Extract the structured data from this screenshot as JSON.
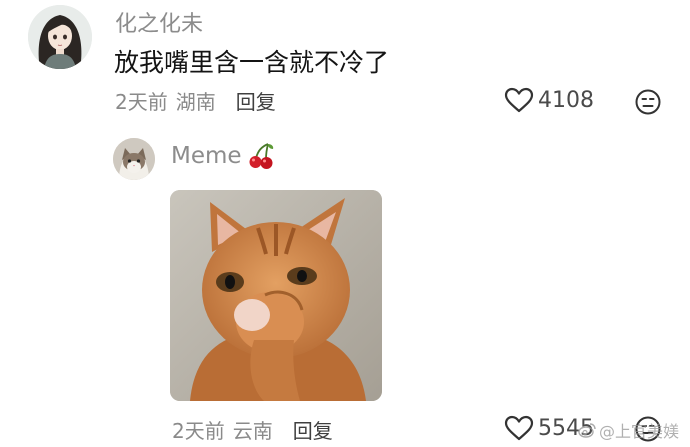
{
  "main_comment": {
    "username": "化之化未",
    "text": "放我嘴里含一含就不冷了",
    "time": "2天前",
    "location": "湖南",
    "reply_label": "回复",
    "likes": "4108",
    "avatar_icon": "anime-girl-avatar",
    "like_icon": "heart-outline-icon",
    "extra_icon": "neutral-face-icon"
  },
  "reply_comment": {
    "username": "Meme",
    "emoji": "cherry-icon",
    "image": "orange-cat-photo",
    "time": "2天前",
    "location": "云南",
    "reply_label": "回复",
    "likes": "5545",
    "avatar_icon": "cat-avatar",
    "like_icon": "heart-outline-icon",
    "extra_icon": "neutral-face-icon"
  },
  "watermark": {
    "text": "@上官美媄",
    "icon": "weibo-logo-icon"
  },
  "colors": {
    "secondary_text": "#8c8c8c",
    "primary_text": "#141414",
    "icon_stroke": "#333333"
  }
}
